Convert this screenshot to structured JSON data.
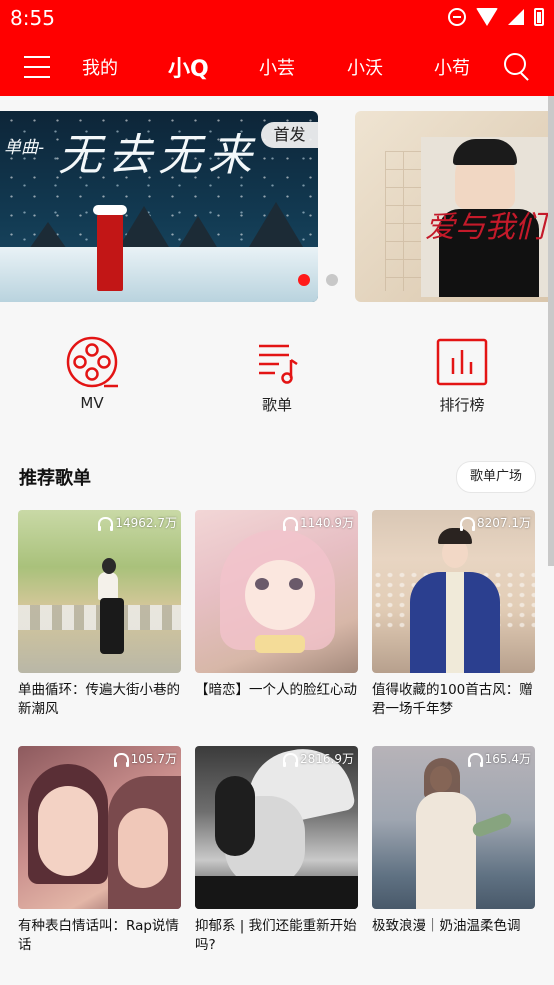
{
  "status": {
    "time": "8:55"
  },
  "nav": {
    "tabs": [
      {
        "label": "我的"
      },
      {
        "label": "小Q"
      },
      {
        "label": "小芸"
      },
      {
        "label": "小沃"
      },
      {
        "label": "小苟"
      }
    ],
    "active_tab": 1
  },
  "banners": [
    {
      "prefix": "单曲-",
      "title": "无去无来",
      "badge": "首发"
    },
    {
      "title": "爱与我们"
    }
  ],
  "banner_pagination": {
    "count": 2,
    "active": 0
  },
  "quick_entries": [
    {
      "label": "MV",
      "icon": "film-reel-icon"
    },
    {
      "label": "歌单",
      "icon": "playlist-icon"
    },
    {
      "label": "排行榜",
      "icon": "chart-icon"
    }
  ],
  "section": {
    "title": "推荐歌单",
    "more_label": "歌单广场"
  },
  "playlists": [
    {
      "count": "14962.7万",
      "caption": "单曲循环：传遍大街小巷的新潮风"
    },
    {
      "count": "1140.9万",
      "caption": "【暗恋】一个人的脸红心动"
    },
    {
      "count": "8207.1万",
      "caption": "值得收藏的100首古风：赠君一场千年梦"
    },
    {
      "count": "105.7万",
      "caption": "有种表白情话叫：Rap说情话"
    },
    {
      "count": "2816.9万",
      "caption": "抑郁系 | 我们还能重新开始吗?"
    },
    {
      "count": "165.4万",
      "caption": "极致浪漫｜奶油温柔色调"
    }
  ],
  "colors": {
    "brand": "#ff0000",
    "accent_icon": "#e31414"
  }
}
